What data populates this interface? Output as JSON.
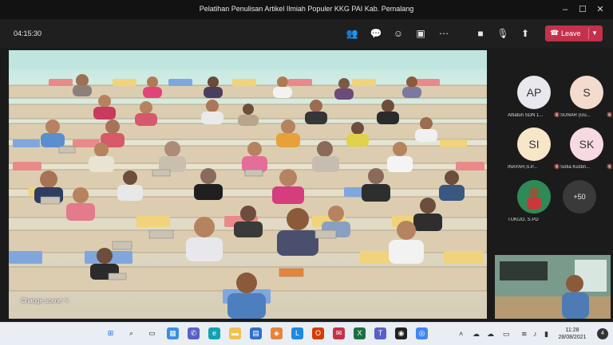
{
  "window": {
    "title": "Pelatihan Penulisan Artikel Ilmiah Populer KKG PAI Kab. Pemalang"
  },
  "toolbar": {
    "timer": "04:15:30",
    "leave_label": "Leave",
    "icons": [
      "people-icon",
      "chat-icon",
      "reactions-icon",
      "rooms-icon",
      "more-icon",
      "camera-icon",
      "mic-icon",
      "share-icon"
    ]
  },
  "stage": {
    "change_scene_label": "Change scene"
  },
  "participants": [
    {
      "initials": "AP",
      "name": "Alfiatun SDN 1...",
      "color": "#e8e8ee"
    },
    {
      "initials": "S",
      "name": "SUNAR (Gu...",
      "color": "#f3dccd"
    },
    {
      "initials": "SI",
      "name": "INAYAH,S.P...",
      "color": "#f7e6c8"
    },
    {
      "initials": "SK",
      "name": "Sofia Kustin...",
      "color": "#f7d9e2"
    },
    {
      "initials": "",
      "name": "TUKIJO, S.PD",
      "color": "#2f8a55"
    }
  ],
  "more_count": "+50",
  "taskbar": {
    "time": "11:28",
    "date": "28/08/2021",
    "notification_count": "4"
  }
}
